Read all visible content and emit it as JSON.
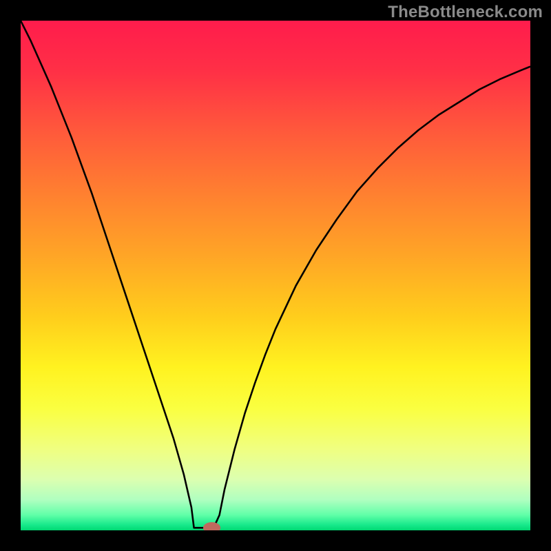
{
  "watermark": "TheBottleneck.com",
  "chart_data": {
    "type": "line",
    "title": "",
    "xlabel": "",
    "ylabel": "",
    "xlim": [
      0,
      100
    ],
    "ylim": [
      0,
      100
    ],
    "grid": false,
    "series": [
      {
        "name": "bottleneck-curve",
        "x": [
          0,
          2,
          4,
          6,
          8,
          10,
          12,
          14,
          16,
          18,
          20,
          22,
          24,
          26,
          28,
          30,
          32,
          33.5,
          34,
          35,
          36,
          37,
          38,
          39,
          40,
          42,
          44,
          46,
          48,
          50,
          54,
          58,
          62,
          66,
          70,
          74,
          78,
          82,
          86,
          90,
          94,
          98,
          100
        ],
        "values": [
          100,
          96,
          91.5,
          87,
          82,
          77,
          71.5,
          66,
          60,
          54,
          48,
          42,
          36,
          30,
          24,
          18,
          11,
          4.5,
          0.5,
          0.5,
          0.5,
          0.5,
          0.8,
          3,
          8,
          16,
          23,
          29,
          34.5,
          39.5,
          48,
          55,
          61,
          66.5,
          71,
          75,
          78.5,
          81.5,
          84,
          86.5,
          88.5,
          90.2,
          91
        ]
      }
    ],
    "notch": {
      "x": 37.5,
      "y": 0.5,
      "rx": 1.7,
      "ry": 1.1
    },
    "background_gradient": {
      "stops": [
        {
          "offset": 0.0,
          "color": "#ff1c4c"
        },
        {
          "offset": 0.1,
          "color": "#ff3046"
        },
        {
          "offset": 0.22,
          "color": "#ff5a3b"
        },
        {
          "offset": 0.34,
          "color": "#ff8030"
        },
        {
          "offset": 0.46,
          "color": "#ffa526"
        },
        {
          "offset": 0.58,
          "color": "#ffcd1c"
        },
        {
          "offset": 0.68,
          "color": "#fff220"
        },
        {
          "offset": 0.76,
          "color": "#faff40"
        },
        {
          "offset": 0.84,
          "color": "#f0ff80"
        },
        {
          "offset": 0.9,
          "color": "#dcffb0"
        },
        {
          "offset": 0.94,
          "color": "#b0ffc0"
        },
        {
          "offset": 0.97,
          "color": "#60ffa8"
        },
        {
          "offset": 0.99,
          "color": "#16e88a"
        },
        {
          "offset": 1.0,
          "color": "#00d872"
        }
      ]
    },
    "notch_color": "#c0695e",
    "curve_color": "#000000"
  }
}
